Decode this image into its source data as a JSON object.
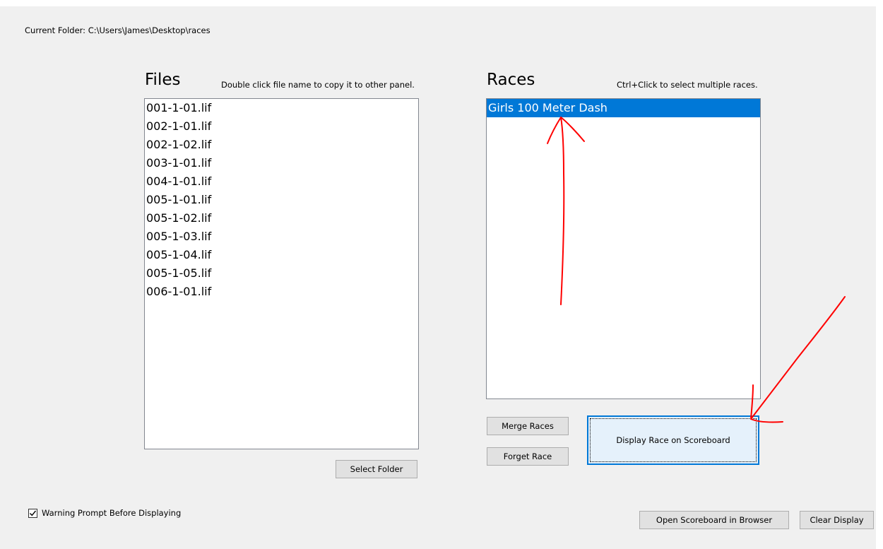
{
  "current_folder_label": "Current Folder: C:\\Users\\James\\Desktop\\races",
  "files_panel": {
    "title": "Files",
    "hint": "Double click file name to copy it to other panel.",
    "items": [
      "001-1-01.lif",
      "002-1-01.lif",
      "002-1-02.lif",
      "003-1-01.lif",
      "004-1-01.lif",
      "005-1-01.lif",
      "005-1-02.lif",
      "005-1-03.lif",
      "005-1-04.lif",
      "005-1-05.lif",
      "006-1-01.lif"
    ],
    "select_folder_label": "Select Folder"
  },
  "races_panel": {
    "title": "Races",
    "hint": "Ctrl+Click to select multiple races.",
    "items": [
      "Girls 100 Meter Dash"
    ],
    "selected_index": 0,
    "merge_label": "Merge Races",
    "forget_label": "Forget Race",
    "display_label": "Display Race on Scoreboard"
  },
  "warning_prompt": {
    "label": "Warning Prompt Before Displaying",
    "checked": true
  },
  "footer": {
    "open_browser_label": "Open Scoreboard in Browser",
    "clear_display_label": "Clear Display"
  },
  "annotation_color": "#ff0000",
  "colors": {
    "selection": "#0078d7",
    "window_bg": "#f0f0f0",
    "list_border": "#828790"
  }
}
